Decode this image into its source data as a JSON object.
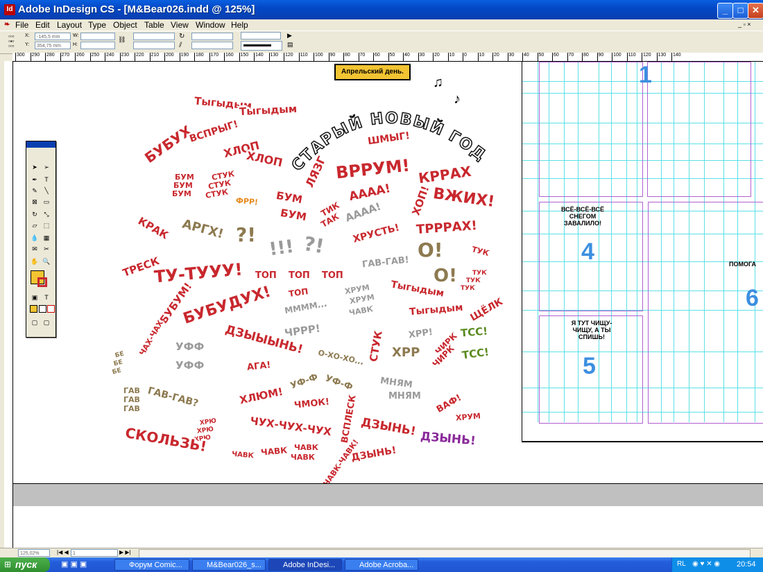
{
  "window": {
    "title": "Adobe InDesign CS - [M&Bear026.indd @ 125%]"
  },
  "menu": [
    "File",
    "Edit",
    "Layout",
    "Type",
    "Object",
    "Table",
    "View",
    "Window",
    "Help"
  ],
  "controls": {
    "x_label": "X:",
    "x_value": "-145,5 mm",
    "y_label": "Y:",
    "y_value": "354,75 mm",
    "w_label": "W:",
    "h_label": "H:"
  },
  "ruler_h": [
    "300",
    "290",
    "280",
    "270",
    "260",
    "250",
    "240",
    "230",
    "220",
    "210",
    "200",
    "190",
    "180",
    "170",
    "160",
    "150",
    "140",
    "130",
    "120",
    "110",
    "100",
    "90",
    "80",
    "70",
    "60",
    "50",
    "40",
    "30",
    "20",
    "10",
    "0",
    "10",
    "20",
    "30",
    "40",
    "50",
    "60",
    "70",
    "80",
    "90",
    "100",
    "110",
    "120",
    "130",
    "140"
  ],
  "page": {
    "title_box": "Апрельский день.",
    "panel_numbers": [
      "1",
      "4",
      "5",
      "6"
    ],
    "texts": [
      "ВСЁ-ВСЁ-ВСЁ СНЕГОМ ЗАВАЛИЛО!",
      "Я ТУТ ЧИЩУ-ЧИЩУ, А ТЫ СПИШЬ!",
      "ПОМОГА"
    ]
  },
  "stickers": {
    "headline": "СТАРЫЙ НОВЫЙ ГОД",
    "s01": "Тыгыдым",
    "s02": "Тыгыдым",
    "s03": "БУБУХ",
    "s04": "ВСПРЫГ!",
    "s05": "ХЛОП",
    "s06": "ХЛОП",
    "s07": "ШМЫГ!",
    "s08": "ВРРУМ!",
    "s09": "КРРАХ",
    "s10": "ЛЯЗГ",
    "s11": "БУМ",
    "s12": "БУМ",
    "s13": "БУМ",
    "s14": "СТУК",
    "s15": "СТУК",
    "s16": "СТУК",
    "s17": "ФРР!",
    "s18": "БУМ",
    "s19": "БУМ",
    "s20": "ТИК",
    "s21": "ТАК",
    "s22": "АААА!",
    "s23": "АААА!",
    "s24": "ХОП!",
    "s25": "ВЖИХ!",
    "s26": "КРАК",
    "s27": "АРГХ!",
    "s28": "?!",
    "s29": "!!!",
    "s30": "?!",
    "s31": "ХРУСТЬ!",
    "s32": "ТРРРАХ!",
    "s33": "О!",
    "s34": "ТУК",
    "s35": "ТРЕСК",
    "s36": "ТУ-ТУУУ!",
    "s37": "ТОП",
    "s38": "ТОП",
    "s39": "ТОП",
    "s40": "ГАВ-ГАВ!",
    "s41": "О!",
    "s42": "ТУК",
    "s43": "ТУК",
    "s44": "ТУК",
    "s45": "БУБУМ!",
    "s46": "БУБУДУХ!",
    "s47": "ТОП",
    "s48": "ММММ...",
    "s49": "ХРУМ",
    "s50": "ХРУМ",
    "s51": "ЧАВК",
    "s52": "Тыгыдым",
    "s53": "Тыгыдым",
    "s54": "ЩЁЛК",
    "s55": "ЧАХ-ЧАХ",
    "s56": "УФФ",
    "s57": "УФФ",
    "s58": "ДЗЫЫЫНЬ!",
    "s59": "ЧРРР!",
    "s60": "СТУК",
    "s61": "ХРР!",
    "s62": "ТСС!",
    "s63": "БЕ",
    "s64": "БЕ",
    "s65": "БЕ",
    "s66": "АГА!",
    "s67": "О-ХО-ХО...",
    "s68": "ХРР",
    "s69": "ЧИРК",
    "s70": "ЧИРК",
    "s71": "ТСС!",
    "s72": "ГАВ",
    "s73": "ГАВ",
    "s74": "ГАВ",
    "s75": "ГАВ-ГАВ?",
    "s76": "УФ-Ф",
    "s77": "УФ-Ф",
    "s78": "МНЯМ",
    "s79": "МНЯМ",
    "s80": "ХЛЮМ!",
    "s81": "ЧМОК!",
    "s82": "ВСПЛЕСК",
    "s83": "ВАФ!",
    "s84": "ХРЮ",
    "s85": "ХРЮ",
    "s86": "ХРЮ",
    "s87": "ЧУХ-ЧУХ-ЧУХ",
    "s88": "ДЗЫНЬ!",
    "s89": "ХРУМ",
    "s90": "СКОЛЬЗЬ!",
    "s91": "ЧАВК",
    "s92": "ЧАВК",
    "s93": "ЧАВК",
    "s94": "ЧАВК",
    "s95": "ЧАВК-ЧАВК!",
    "s96": "ДЗЫНЬ!",
    "s97": "ДЗЫНЬ!"
  },
  "status": {
    "zoom": "125,02%",
    "page": "1"
  },
  "taskbar": {
    "start": "пуск",
    "tasks": [
      "Форум Comic...",
      "M&Bear026_s...",
      "Adobe InDesi...",
      "Adobe Acroba..."
    ],
    "lang": "RL",
    "clock": "20:54"
  }
}
